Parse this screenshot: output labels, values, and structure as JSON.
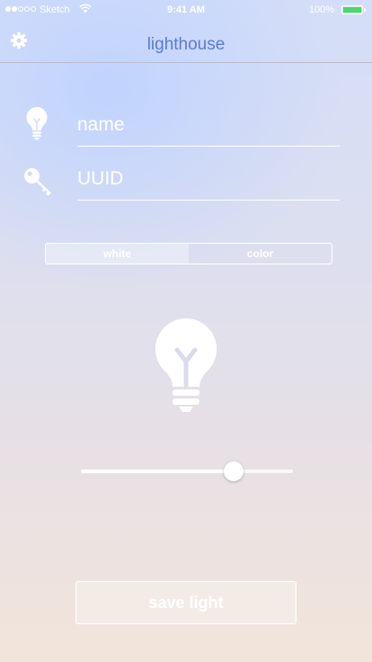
{
  "status_bar": {
    "carrier": "Sketch",
    "time": "9:41 AM",
    "battery": "100%",
    "icons": [
      "signal-dots-icon",
      "wifi-icon",
      "battery-icon"
    ]
  },
  "nav": {
    "title": "lighthouse",
    "settings_icon": "gear-icon"
  },
  "form": {
    "name_placeholder": "name",
    "uuid_placeholder": "UUID",
    "name_icon": "lightbulb-icon",
    "uuid_icon": "key-icon"
  },
  "mode": {
    "options": [
      "white",
      "color"
    ],
    "selected": "white"
  },
  "brightness": {
    "icon": "lightbulb-icon",
    "level": 0.72
  },
  "actions": {
    "save_label": "save light"
  },
  "colors": {
    "accent": "#5b7bd2",
    "battery": "#4cd964",
    "foreground": "#ffffff"
  }
}
